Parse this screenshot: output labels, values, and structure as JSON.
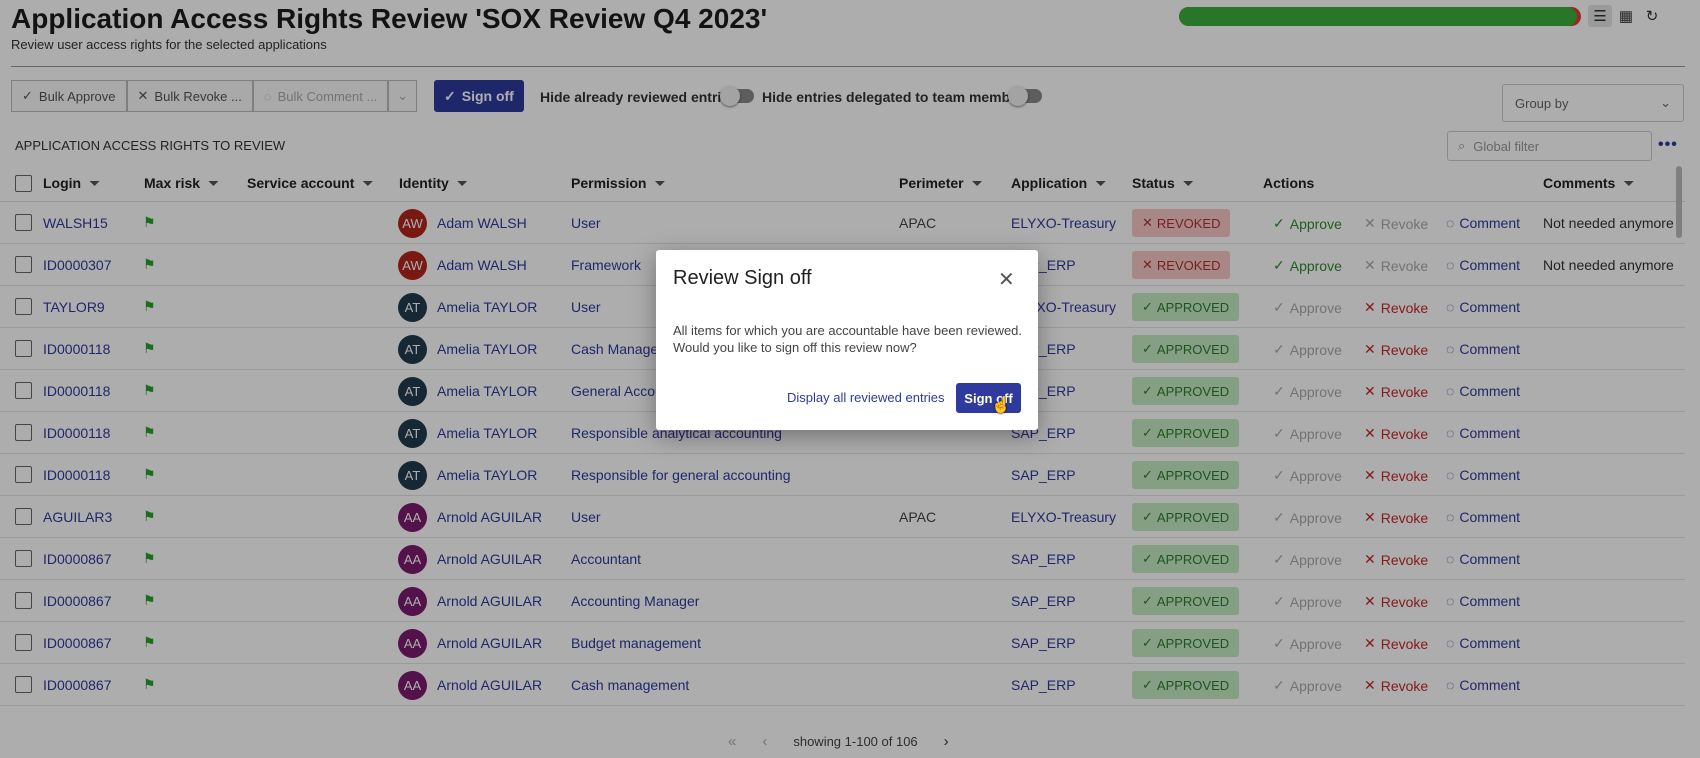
{
  "header": {
    "title": "Application Access Rights Review 'SOX Review Q4 2023'",
    "subtitle": "Review user access rights for the selected applications",
    "progress_fraction": 0.99,
    "list_view_icon": "list-icon",
    "grid_view_icon": "grid-icon",
    "refresh_icon": "refresh-icon"
  },
  "toolbar": {
    "bulk_approve": "Bulk Approve",
    "bulk_revoke": "Bulk Revoke ...",
    "bulk_comment": "Bulk Comment ...",
    "sign_off": "Sign off",
    "hide_reviewed": "Hide already reviewed entries",
    "hide_delegated": "Hide entries delegated to team members",
    "group_by_placeholder": "Group by"
  },
  "section_title": "APPLICATION ACCESS RIGHTS TO REVIEW",
  "global_filter_placeholder": "Global filter",
  "columns": {
    "login": "Login",
    "max_risk": "Max risk",
    "service_account": "Service account",
    "identity": "Identity",
    "permission": "Permission",
    "perimeter": "Perimeter",
    "application": "Application",
    "status": "Status",
    "actions": "Actions",
    "comments": "Comments"
  },
  "action_labels": {
    "approve": "Approve",
    "revoke": "Revoke",
    "comment": "Comment"
  },
  "rows": [
    {
      "login": "WALSH15",
      "initials": "AW",
      "identity": "Adam WALSH",
      "avatar_color": "#b3261e",
      "permission": "User",
      "perimeter": "APAC",
      "application": "ELYXO-Treasury",
      "status": "REVOKED",
      "comment": "Not needed anymore"
    },
    {
      "login": "ID0000307",
      "initials": "AW",
      "identity": "Adam WALSH",
      "avatar_color": "#b3261e",
      "permission": "Framework",
      "perimeter": "",
      "application": "SAP_ERP",
      "status": "REVOKED",
      "comment": "Not needed anymore"
    },
    {
      "login": "TAYLOR9",
      "initials": "AT",
      "identity": "Amelia TAYLOR",
      "avatar_color": "#1f3b4d",
      "permission": "User",
      "perimeter": "",
      "application": "ELYXO-Treasury",
      "status": "APPROVED",
      "comment": ""
    },
    {
      "login": "ID0000118",
      "initials": "AT",
      "identity": "Amelia TAYLOR",
      "avatar_color": "#1f3b4d",
      "permission": "Cash Manager",
      "perimeter": "",
      "application": "SAP_ERP",
      "status": "APPROVED",
      "comment": ""
    },
    {
      "login": "ID0000118",
      "initials": "AT",
      "identity": "Amelia TAYLOR",
      "avatar_color": "#1f3b4d",
      "permission": "General Accounting",
      "perimeter": "",
      "application": "SAP_ERP",
      "status": "APPROVED",
      "comment": ""
    },
    {
      "login": "ID0000118",
      "initials": "AT",
      "identity": "Amelia TAYLOR",
      "avatar_color": "#1f3b4d",
      "permission": "Responsible analytical accounting",
      "perimeter": "",
      "application": "SAP_ERP",
      "status": "APPROVED",
      "comment": ""
    },
    {
      "login": "ID0000118",
      "initials": "AT",
      "identity": "Amelia TAYLOR",
      "avatar_color": "#1f3b4d",
      "permission": "Responsible for general accounting",
      "perimeter": "",
      "application": "SAP_ERP",
      "status": "APPROVED",
      "comment": ""
    },
    {
      "login": "AGUILAR3",
      "initials": "AA",
      "identity": "Arnold AGUILAR",
      "avatar_color": "#7b1b6e",
      "permission": "User",
      "perimeter": "APAC",
      "application": "ELYXO-Treasury",
      "status": "APPROVED",
      "comment": ""
    },
    {
      "login": "ID0000867",
      "initials": "AA",
      "identity": "Arnold AGUILAR",
      "avatar_color": "#7b1b6e",
      "permission": "Accountant",
      "perimeter": "",
      "application": "SAP_ERP",
      "status": "APPROVED",
      "comment": ""
    },
    {
      "login": "ID0000867",
      "initials": "AA",
      "identity": "Arnold AGUILAR",
      "avatar_color": "#7b1b6e",
      "permission": "Accounting Manager",
      "perimeter": "",
      "application": "SAP_ERP",
      "status": "APPROVED",
      "comment": ""
    },
    {
      "login": "ID0000867",
      "initials": "AA",
      "identity": "Arnold AGUILAR",
      "avatar_color": "#7b1b6e",
      "permission": "Budget management",
      "perimeter": "",
      "application": "SAP_ERP",
      "status": "APPROVED",
      "comment": ""
    },
    {
      "login": "ID0000867",
      "initials": "AA",
      "identity": "Arnold AGUILAR",
      "avatar_color": "#7b1b6e",
      "permission": "Cash management",
      "perimeter": "",
      "application": "SAP_ERP",
      "status": "APPROVED",
      "comment": ""
    }
  ],
  "pager": {
    "text": "showing 1-100 of 106"
  },
  "modal": {
    "title": "Review Sign off",
    "line1": "All items for which you are accountable have been reviewed.",
    "line2": "Would you like to sign off this review now?",
    "display_link": "Display all reviewed entries",
    "sign_off": "Sign off"
  },
  "colors": {
    "accent": "#2e3a9e",
    "approve": "#2e8b2e",
    "revoke": "#c62828",
    "progress": "#3cae3c"
  }
}
